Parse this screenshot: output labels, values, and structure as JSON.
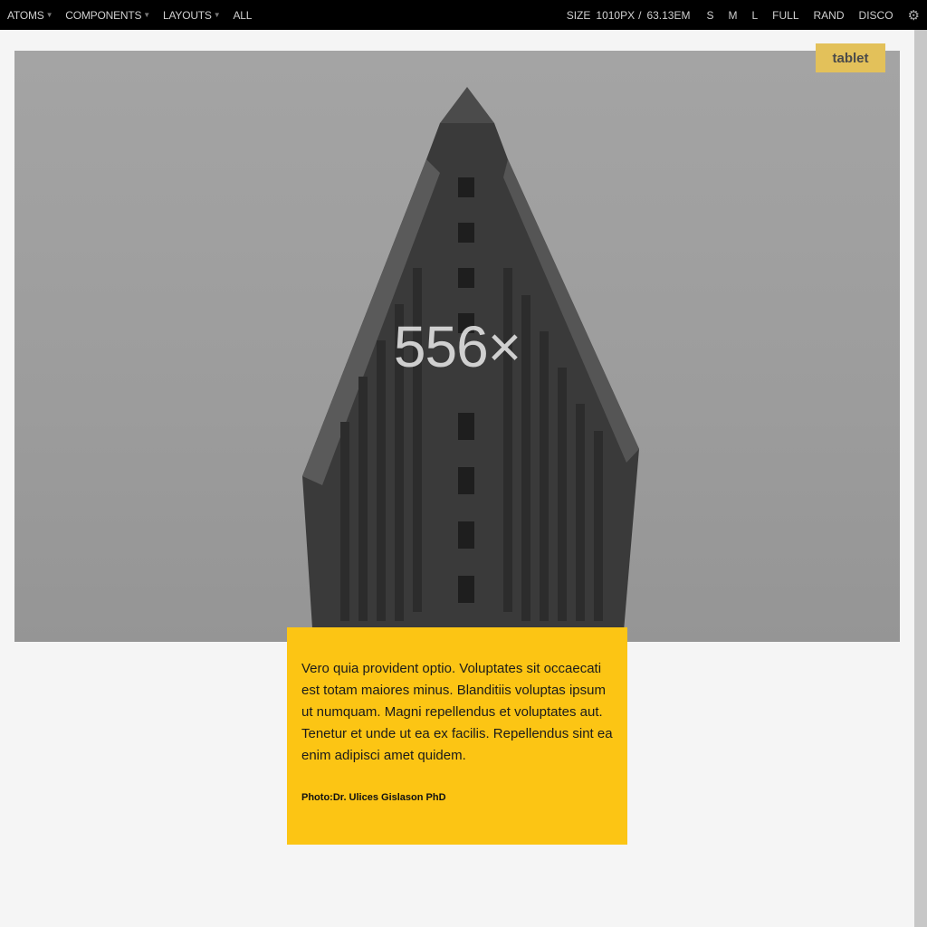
{
  "toolbar": {
    "nav": [
      {
        "label": "ATOMS",
        "caret": true
      },
      {
        "label": "COMPONENTS",
        "caret": true
      },
      {
        "label": "LAYOUTS",
        "caret": true
      },
      {
        "label": "ALL",
        "caret": false
      }
    ],
    "size_label": "SIZE",
    "size_px": "1010PX",
    "size_sep": "/",
    "size_em": "63.13EM",
    "buttons": [
      "S",
      "M",
      "L",
      "FULL",
      "RAND",
      "DISCO"
    ],
    "settings_icon": "gear-icon"
  },
  "badge": {
    "label": "tablet",
    "color": "#e3c15a"
  },
  "hero": {
    "watermark": "556×"
  },
  "caption": {
    "text": "Vero quia provident optio. Voluptates sit occaecati est totam maiores minus. Blanditiis voluptas ipsum ut numquam. Magni repellendus et voluptates aut. Tenetur et unde ut ea ex facilis. Repellendus sint ea enim adipisci amet quidem.",
    "credit": "Photo:Dr. Ulices Gislason PhD",
    "background": "#fcc514"
  }
}
